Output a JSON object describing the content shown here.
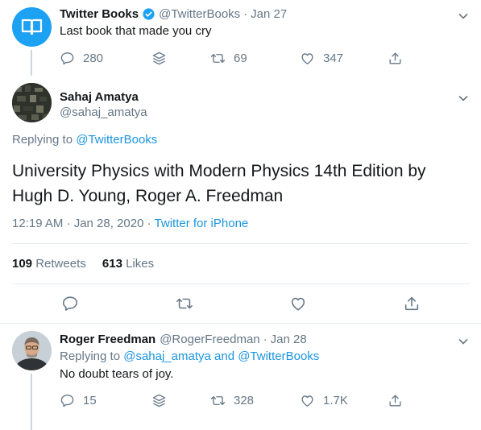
{
  "tweet1": {
    "name": "Twitter Books",
    "handle": "@TwitterBooks",
    "sep": "·",
    "date": "Jan 27",
    "text": "Last book that made you cry",
    "replies": "280",
    "retweets": "69",
    "likes": "347"
  },
  "main": {
    "name": "Sahaj Amatya",
    "handle": "@sahaj_amatya",
    "replying_prefix": "Replying to",
    "replying_to": "@TwitterBooks",
    "text_line1": "University Physics with Modern Physics 14th Edition by",
    "text_line2": "Hugh D. Young, Roger A. Freedman",
    "timestamp": "12:19 AM · Jan 28, 2020 ·",
    "source": "Twitter for iPhone",
    "retweet_count": "109",
    "retweet_label": "Retweets",
    "like_count": "613",
    "like_label": "Likes"
  },
  "reply": {
    "name": "Roger Freedman",
    "handle": "@RogerFreedman",
    "sep": "·",
    "date": "Jan 28",
    "replying_prefix": "Replying to",
    "replying_to": "@sahaj_amatya and @TwitterBooks",
    "text": "No doubt tears of joy.",
    "replies": "15",
    "retweets": "328",
    "likes": "1.7K"
  },
  "colors": {
    "accent": "#1da1f2",
    "link": "#1b95e0",
    "muted": "#657786",
    "border": "#e6ecf0"
  },
  "icons": [
    "book-icon",
    "verified-badge-icon",
    "chevron-down-icon",
    "reply-icon",
    "stack-icon",
    "retweet-icon",
    "like-icon",
    "share-icon"
  ]
}
